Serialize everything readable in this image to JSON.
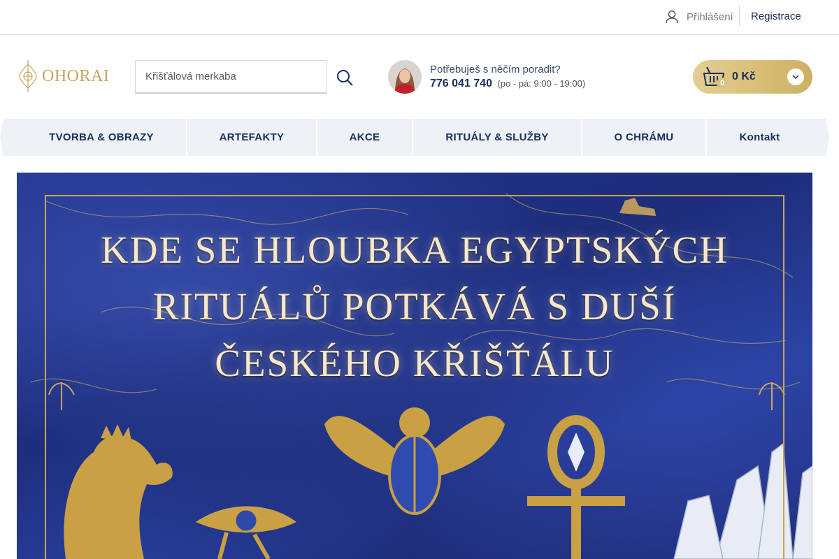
{
  "topbar": {
    "login_label": "Přihlášení",
    "register_label": "Registrace"
  },
  "header": {
    "logo_text": "OHORAI",
    "search": {
      "value": "Křišťálová merkaba",
      "placeholder": "Křišťálová merkaba"
    },
    "advisor": {
      "question": "Potřebuješ s něčím poradit?",
      "phone": "776 041 740",
      "hours": "(po - pá: 9:00 - 19:00)"
    },
    "cart": {
      "count": "0",
      "total": "0 Kč"
    }
  },
  "nav": {
    "items": [
      {
        "label": "TVORBA & OBRAZY"
      },
      {
        "label": "ARTEFAKTY"
      },
      {
        "label": "AKCE"
      },
      {
        "label": "RITUÁLY & SLUŽBY"
      },
      {
        "label": "O CHRÁMU"
      },
      {
        "label": "Kontakt"
      }
    ]
  },
  "hero": {
    "title_lines": [
      "KDE SE HLOUBKA EGYPTSKÝCH",
      "RITUÁLŮ POTKÁVÁ S DUŠÍ",
      "ČESKÉHO KŘIŠŤÁLU"
    ]
  },
  "colors": {
    "brand_gold": "#c9a45c",
    "navy": "#16305e",
    "nav_bg": "#eef2f7",
    "hero_blue": "#23388f"
  },
  "icons": [
    "user-icon",
    "search-icon",
    "basket-icon",
    "chevron-down-icon",
    "lotus-logo-icon"
  ]
}
